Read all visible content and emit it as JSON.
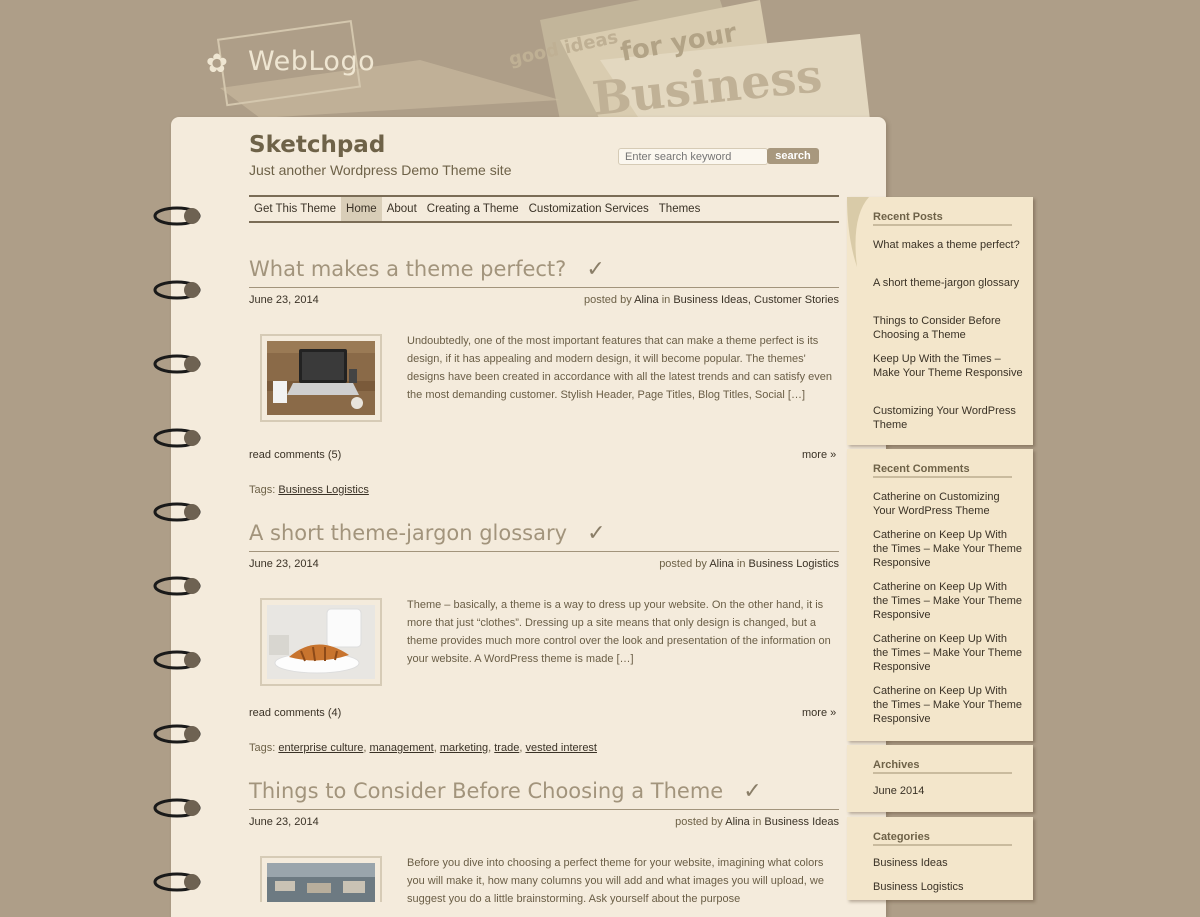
{
  "header": {
    "logo_text": "WebLogo",
    "banner_text_1": "good ideas",
    "banner_text_2": "for your",
    "banner_text_3": "Business"
  },
  "site": {
    "title": "Sketchpad",
    "description": "Just another Wordpress Demo Theme site"
  },
  "search": {
    "placeholder": "Enter search keyword",
    "button": "search"
  },
  "nav": {
    "items": [
      "Get This Theme",
      "Home",
      "About",
      "Creating a Theme",
      "Customization Services",
      "Themes"
    ],
    "active": "Home"
  },
  "posts": [
    {
      "title": "What makes a theme perfect?",
      "date": "June 23, 2014",
      "posted_by": "posted by",
      "author": "Alina",
      "in": "in",
      "categories": "Business Ideas, Customer Stories",
      "excerpt": "Undoubtedly, one of the most important features that can make a theme perfect is its design, if it has appealing and modern design, it will become popular. The themes' designs have been created in accordance with all the latest trends and can satisfy even the most demanding customer. Stylish Header, Page Titles, Blog Titles, Social […]",
      "comments": "read comments (5)",
      "more": "more »",
      "tags_label": "Tags:",
      "tags": "Business Logistics"
    },
    {
      "title": "A short theme-jargon glossary",
      "date": "June 23, 2014",
      "posted_by": "posted by",
      "author": "Alina",
      "in": "in",
      "categories": "Business Logistics",
      "excerpt": "Theme – basically, a theme is a way to dress up your website. On the other hand, it is more that just “clothes”. Dressing up a site means that only design is changed, but a theme provides much more control over the look and presentation of the information on your website. A WordPress theme is made […]",
      "comments": "read comments (4)",
      "more": "more »",
      "tags_label": "Tags:",
      "tags": [
        "enterprise culture",
        "management",
        "marketing",
        "trade",
        "vested interest"
      ]
    },
    {
      "title": "Things to Consider Before Choosing a Theme",
      "date": "June 23, 2014",
      "posted_by": "posted by",
      "author": "Alina",
      "in": "in",
      "categories": "Business Ideas",
      "excerpt": "Before you dive into choosing a perfect theme for your website, imagining what colors you will make it, how many columns you will add and what images you will upload, we suggest you do a little brainstorming. Ask yourself about the purpose"
    }
  ],
  "sidebar": {
    "recent_posts": {
      "title": "Recent Posts",
      "items": [
        "What makes a theme perfect?",
        "A short theme-jargon glossary",
        "Things to Consider Before Choosing a Theme",
        "Keep Up With the Times – Make Your Theme Responsive",
        "Customizing Your WordPress Theme"
      ]
    },
    "recent_comments": {
      "title": "Recent Comments",
      "items": [
        {
          "author": "Catherine",
          "on": "on",
          "post": "Customizing Your WordPress Theme"
        },
        {
          "author": "Catherine",
          "on": "on",
          "post": "Keep Up With the Times – Make Your Theme Responsive"
        },
        {
          "author": "Catherine",
          "on": "on",
          "post": "Keep Up With the Times – Make Your Theme Responsive"
        },
        {
          "author": "Catherine",
          "on": "on",
          "post": "Keep Up With the Times – Make Your Theme Responsive"
        },
        {
          "author": "Catherine",
          "on": "on",
          "post": "Keep Up With the Times – Make Your Theme Responsive"
        }
      ]
    },
    "archives": {
      "title": "Archives",
      "items": [
        "June 2014"
      ]
    },
    "categories": {
      "title": "Categories",
      "items": [
        "Business Ideas",
        "Business Logistics"
      ]
    }
  },
  "colors": {
    "background": "#ae9e88",
    "page": "#f4ebdc",
    "sidebar": "#f3e6cb",
    "title_text": "#a2947c",
    "accent": "#a8987e"
  },
  "icons": [
    "flower-logo-icon",
    "check-icon",
    "spiral-ring-icon"
  ]
}
